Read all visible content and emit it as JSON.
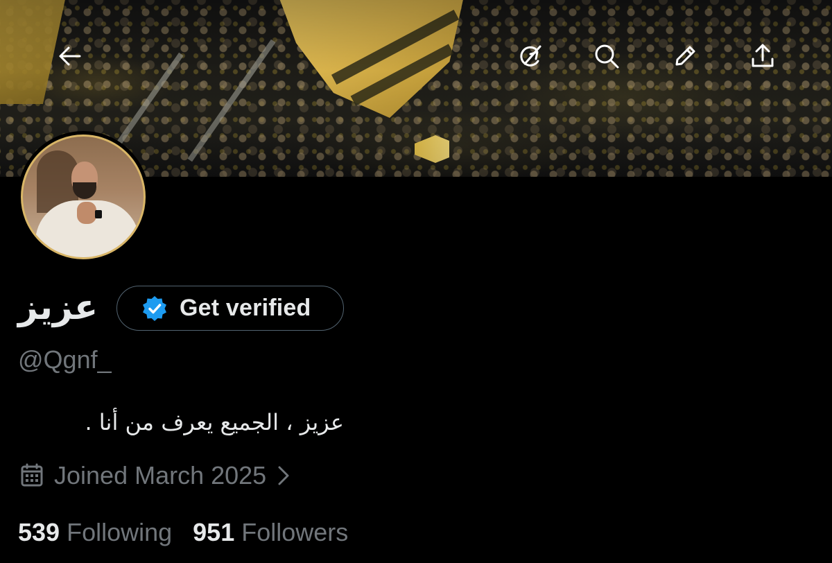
{
  "profile": {
    "name": "عزيز",
    "handle": "@Qgnf_",
    "bio": "عزيز ، الجميع يعرف من أنا .",
    "joined": "Joined March 2025",
    "get_verified_label": "Get verified"
  },
  "stats": {
    "following_count": "539",
    "following_label": "Following",
    "followers_count": "951",
    "followers_label": "Followers"
  },
  "top_bar": {
    "icons": [
      "back-arrow-icon",
      "grok-icon",
      "search-icon",
      "pencil-icon",
      "share-icon"
    ]
  },
  "colors": {
    "background": "#000000",
    "primary_text": "#e7e9ea",
    "secondary_text": "#71767b",
    "verified_blue": "#1d9bf0",
    "avatar_ring": "#d9b667"
  }
}
